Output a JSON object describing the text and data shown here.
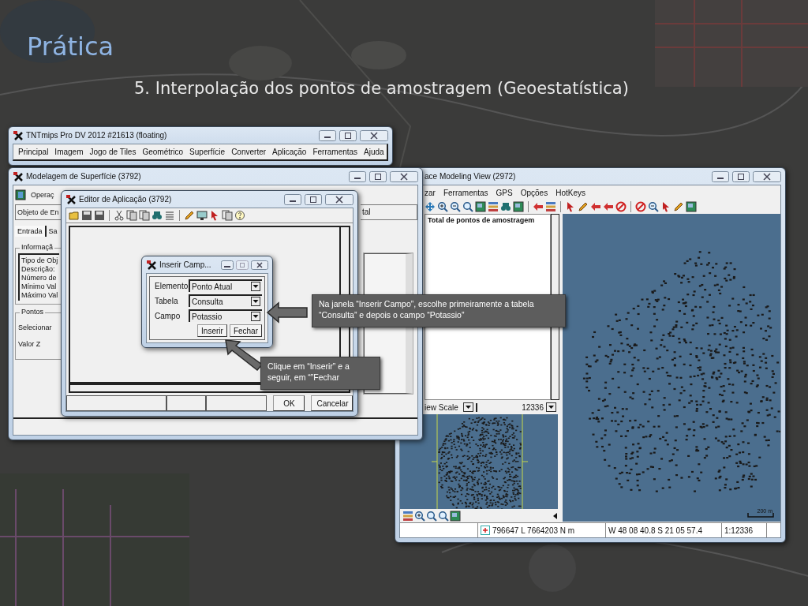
{
  "slide": {
    "title": "Prática",
    "subtitle": "5. Interpolação dos pontos de amostragem (Geoestatística)"
  },
  "main_window": {
    "title": "TNTmips Pro DV 2012  #21613 (floating)",
    "menu": [
      "Principal",
      "Imagem",
      "Jogo de Tiles",
      "Geométrico",
      "Superfície",
      "Converter",
      "Aplicação",
      "Ferramentas",
      "Ajuda"
    ]
  },
  "surface_window": {
    "title": "Modelagem de Superfície (3792)",
    "operation_label": "Operaç",
    "object_label": "Objeto de En",
    "right_field": "tal",
    "tabs": [
      {
        "label": "Entrada",
        "selected": true
      },
      {
        "label": "Sa",
        "selected": false
      }
    ],
    "info_group": {
      "title": "Informaçã",
      "lines": [
        "Tipo de Obj",
        "Descrição:",
        "Número de",
        "Mínimo Val",
        "Máximo Val"
      ]
    },
    "points_group": {
      "title": "Pontos",
      "rows": [
        "Selecionar",
        "Valor Z"
      ]
    }
  },
  "editor_window": {
    "title": "Editor de Aplicação (3792)",
    "buttons": [
      "OK",
      "Cancelar"
    ]
  },
  "insert_dialog": {
    "title": "Inserir Camp...",
    "fields": [
      {
        "label": "Elemento",
        "value": "Ponto Atual"
      },
      {
        "label": "Tabela",
        "value": "Consulta"
      },
      {
        "label": "Campo",
        "value": "Potassio"
      }
    ],
    "buttons": [
      "Inserir",
      "Fechar"
    ]
  },
  "view_window": {
    "title": "ace Modeling View (2972)",
    "menu": [
      "zar",
      "Ferramentas",
      "GPS",
      "Opções",
      "HotKeys"
    ],
    "legend_label": "Total de pontos de amostragem",
    "scale_label": "iew Scale",
    "scale_value": "12336",
    "map_scale": "200 m",
    "status": [
      "796647 L  7664203 N m",
      "W 48 08 40.8  S 21 05 57.4",
      "1:12336"
    ]
  },
  "callouts": [
    {
      "text": "Na janela “Inserir Campo”, escolhe primeiramente a tabela “Consulta” e depois o campo “Potassio”"
    },
    {
      "text": "Clique em “Inserir” e a seguir, em “”Fechar"
    }
  ]
}
